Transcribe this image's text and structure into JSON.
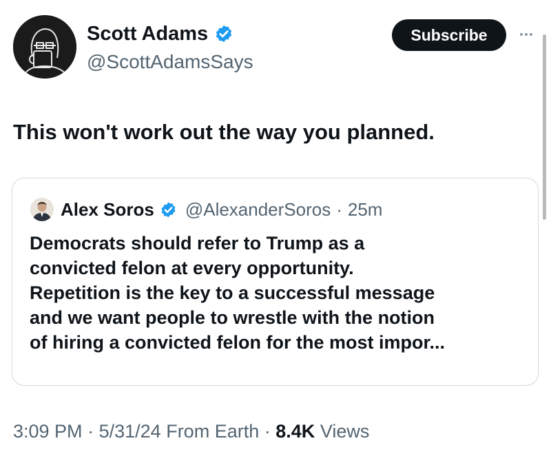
{
  "author": {
    "display_name": "Scott Adams",
    "handle": "@ScottAdamsSays",
    "verified": true
  },
  "actions": {
    "subscribe_label": "Subscribe",
    "more_icon": "more-horizontal-icon"
  },
  "tweet": {
    "text": "This won't work out the way you planned."
  },
  "quote": {
    "display_name": "Alex Soros",
    "handle": "@AlexanderSoros",
    "separator": "·",
    "time": "25m",
    "verified": true,
    "lines": [
      "Democrats should refer to Trump as a",
      "convicted felon at every opportunity.",
      "Repetition is the key to a successful message",
      "and we want people to wrestle with the notion",
      "of hiring a convicted felon for the most impor..."
    ]
  },
  "meta": {
    "time": "3:09 PM",
    "separator": "·",
    "date": "5/31/24",
    "source": "From Earth",
    "views_count": "8.4K",
    "views_label": "Views"
  },
  "colors": {
    "verified_blue": "#1d9bf0",
    "text_primary": "#0f1419",
    "text_secondary": "#536471",
    "border": "#cfd9de"
  }
}
